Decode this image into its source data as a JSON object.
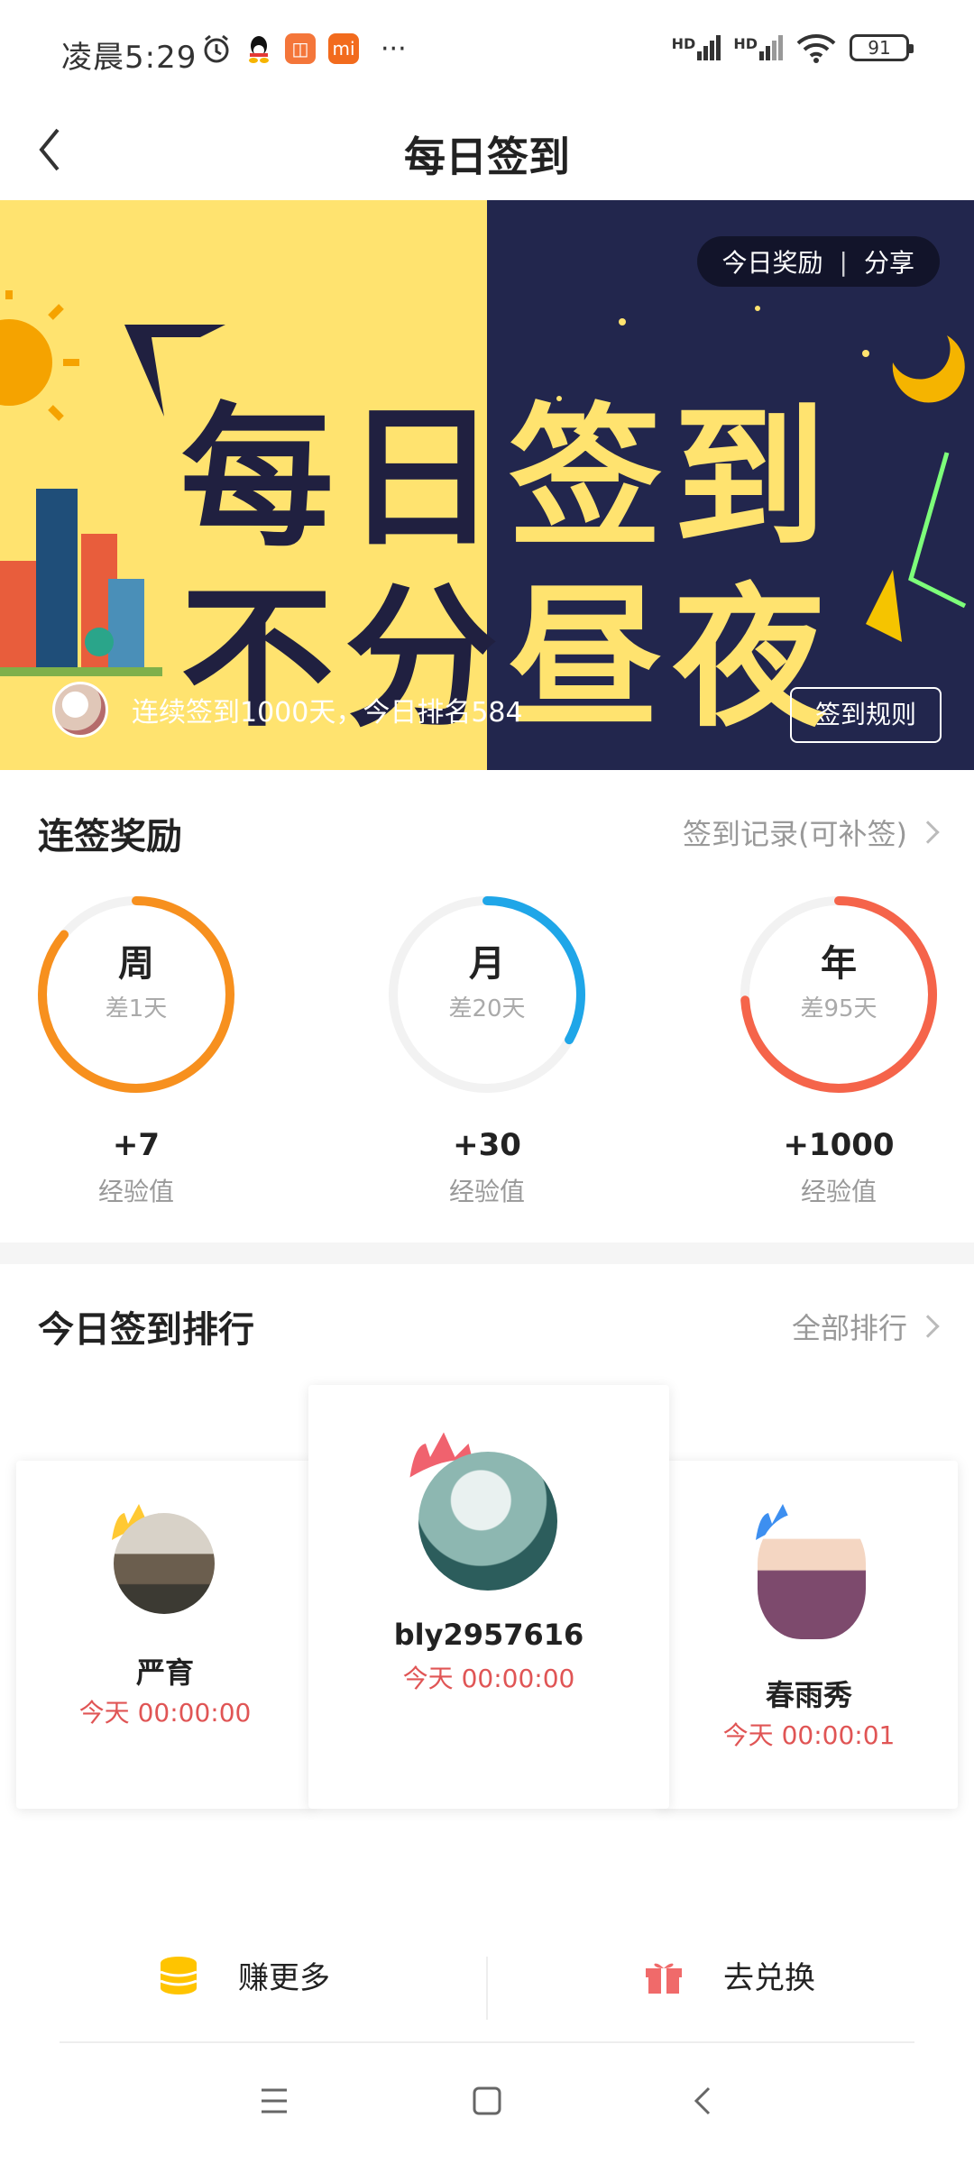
{
  "status": {
    "time": "凌晨5:29",
    "battery": "91",
    "network_labels": [
      "HD",
      "HD"
    ],
    "overflow": "···"
  },
  "header": {
    "title": "每日签到"
  },
  "banner": {
    "line1": [
      "每",
      "日",
      "签",
      "到"
    ],
    "line2": [
      "不",
      "分",
      "昼",
      "夜"
    ],
    "today_reward": "今日奖励",
    "pill_sep": "|",
    "share": "分享",
    "streak_text": "连续签到1000天，今日排名584",
    "rules_button": "签到规则"
  },
  "rewards": {
    "title": "连签奖励",
    "record_link": "签到记录(可补签)",
    "items": [
      {
        "label": "周",
        "remaining": "差1天",
        "value": "+7",
        "unit": "经验值",
        "color": "#f7901e",
        "progress": 0.86
      },
      {
        "label": "月",
        "remaining": "差20天",
        "value": "+30",
        "unit": "经验值",
        "color": "#1fa6e8",
        "progress": 0.33
      },
      {
        "label": "年",
        "remaining": "差95天",
        "value": "+1000",
        "unit": "经验值",
        "color": "#f5644a",
        "progress": 0.74
      }
    ]
  },
  "ranking": {
    "title": "今日签到排行",
    "all_link": "全部排行",
    "entries": [
      {
        "rank": 1,
        "name": "bly2957616",
        "time": "今天 00:00:00",
        "crown_color": "#f0626e"
      },
      {
        "rank": 2,
        "name": "严育",
        "time": "今天 00:00:00",
        "crown_color": "#ffc933"
      },
      {
        "rank": 3,
        "name": "春雨秀",
        "time": "今天 00:00:01",
        "crown_color": "#3d8ff0"
      }
    ]
  },
  "bottom": {
    "earn_more": "赚更多",
    "exchange": "去兑换"
  },
  "icons": {
    "back": "back-arrow-icon",
    "coin": "coin-stack-icon",
    "gift": "gift-icon",
    "menu": "menu-icon",
    "home": "home-icon",
    "nav_back": "nav-back-icon"
  }
}
